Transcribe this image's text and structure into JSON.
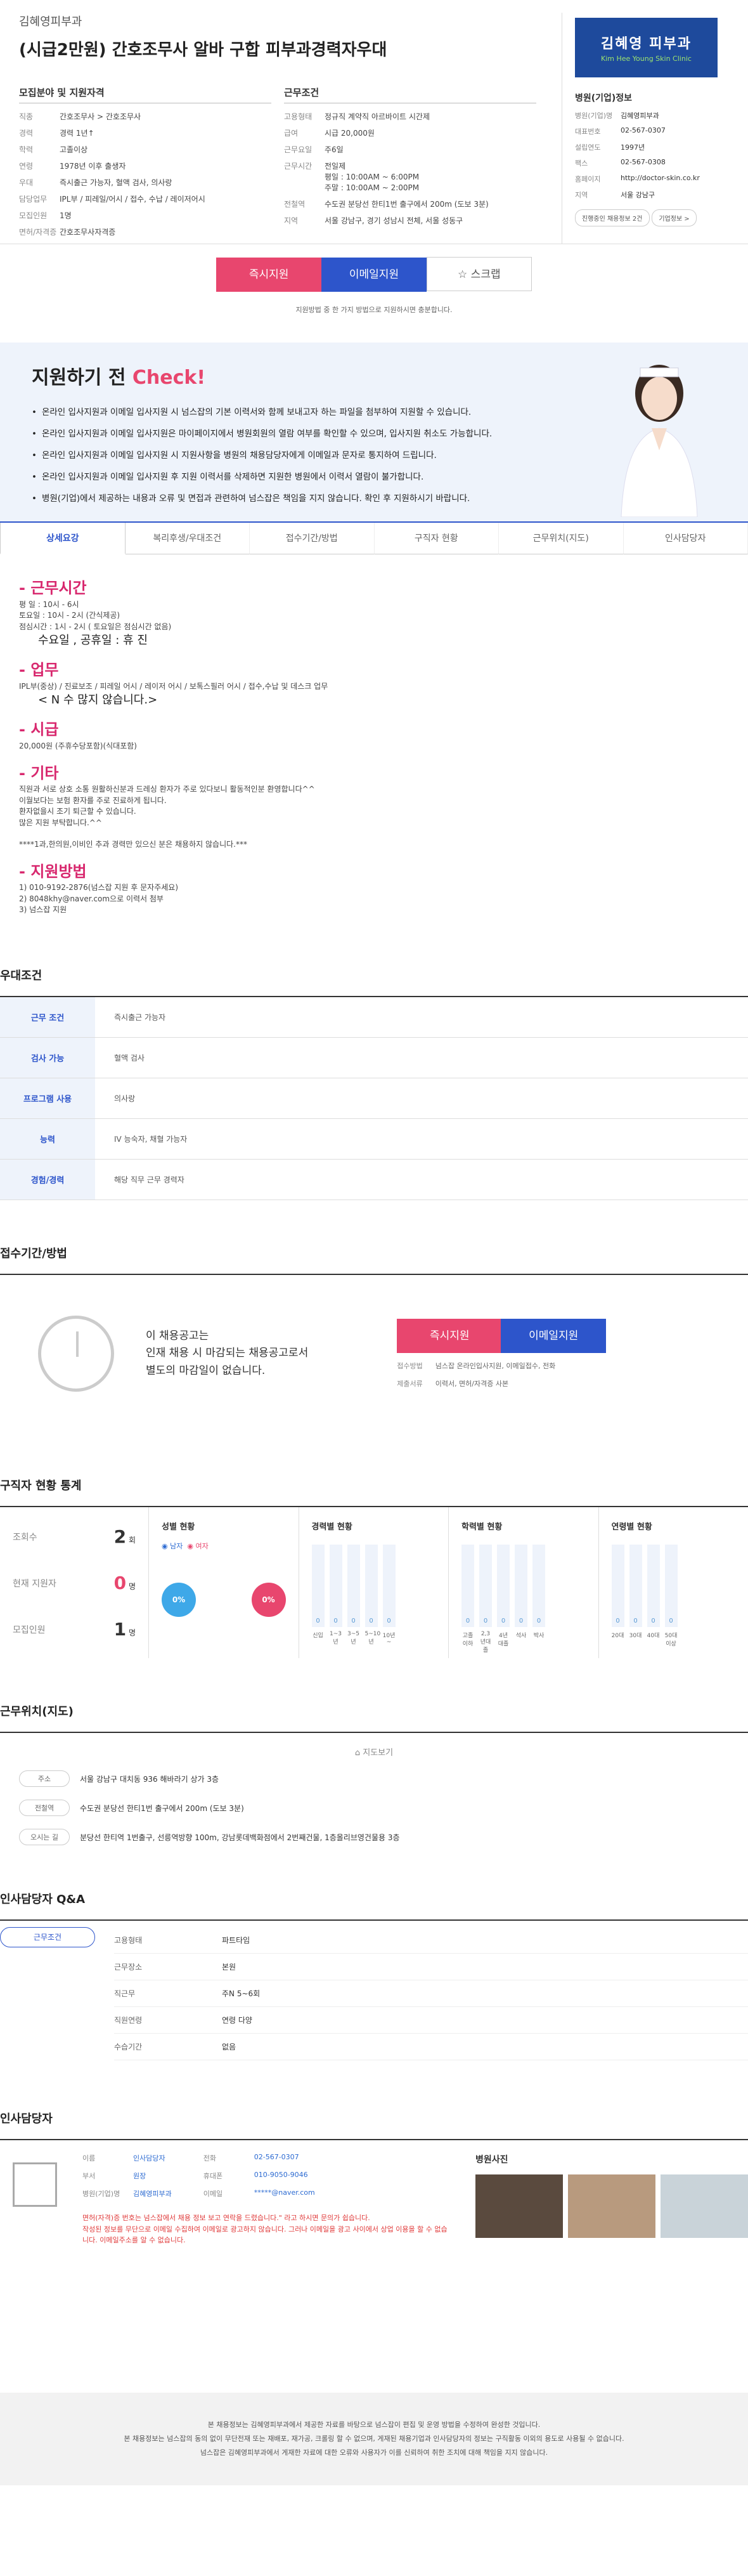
{
  "header": {
    "clinic": "김혜영피부과",
    "title": "(시급2만원) 간호조무사 알바 구합 피부과경력자우대"
  },
  "recruit": {
    "title": "모집분야 및 지원자격",
    "rows": [
      {
        "k": "직종",
        "v": "간호조무사 > 간호조무사"
      },
      {
        "k": "경력",
        "v": "경력 1년↑"
      },
      {
        "k": "학력",
        "v": "고졸이상"
      },
      {
        "k": "연령",
        "v": "1978년 이후 출생자"
      },
      {
        "k": "우대",
        "v": "즉시출근 가능자, 혈액 검사, 의사랑"
      },
      {
        "k": "담당업무",
        "v": "IPL부 / 피레일/어시 / 접수, 수납 / 레이저어시"
      },
      {
        "k": "모집인원",
        "v": "1명"
      },
      {
        "k": "면허/자격증",
        "v": "간호조무사자격증"
      }
    ]
  },
  "work": {
    "title": "근무조건",
    "rows": [
      {
        "k": "고용형태",
        "v": "정규직  계약직  아르바이트  시간제"
      },
      {
        "k": "급여",
        "v": "시급 20,000원"
      },
      {
        "k": "근무요일",
        "v": "주6일"
      },
      {
        "k": "근무시간",
        "v": "전일제\n평일 : 10:00AM ~ 6:00PM\n주말 : 10:00AM ~ 2:00PM"
      },
      {
        "k": "전철역",
        "v": "수도권 분당선 한티1번 출구에서 200m (도보 3분)"
      },
      {
        "k": "지역",
        "v": "서울 강남구, 경기 성남시 전체, 서울 성동구"
      }
    ]
  },
  "hospital": {
    "logo1": "김혜영 피부과",
    "logo2": "Kim Hee Young Skin Clinic",
    "title": "병원(기업)정보",
    "rows": [
      {
        "k": "병원(기업)명",
        "v": "김혜영피부과"
      },
      {
        "k": "대표번호",
        "v": "02-567-0307"
      },
      {
        "k": "설립연도",
        "v": "1997년"
      },
      {
        "k": "팩스",
        "v": "02-567-0308"
      },
      {
        "k": "홈페이지",
        "v": "http://doctor-skin.co.kr"
      },
      {
        "k": "지역",
        "v": "서울 강남구"
      }
    ],
    "btn1": "진행중인 채용정보 2건",
    "btn2": "기업정보 >"
  },
  "apply": {
    "instant": "즉시지원",
    "email": "이메일지원",
    "scrap": "☆ 스크랩",
    "note": "지원방법 중 한 가지 방법으로 지원하시면 충분합니다."
  },
  "check": {
    "t1": "지원하기 전 ",
    "t2": "Check!",
    "items": [
      "온라인 입사지원과 이메일 입사지원 시 넘스잡의 기본 이력서와 함께 보내고자 하는 파일을 첨부하여 지원할 수 있습니다.",
      "온라인 입사지원과 이메일 입사지원은 마이페이지에서 병원회원의 열람 여부를 확인할 수 있으며, 입사지원 취소도 가능합니다.",
      "온라인 입사지원과 이메일 입사지원 시 지원사항을 병원의 채용담당자에게 이메일과 문자로 통지하여 드립니다.",
      "온라인 입사지원과 이메일 입사지원 후 지원 이력서를 삭제하면 지원한 병원에서 이력서 열람이 불가합니다.",
      "병원(기업)에서 제공하는 내용과 오류 및 면접과 관련하여 넘스잡은 책임을 지지 않습니다. 확인 후 지원하시기 바랍니다."
    ]
  },
  "tabs": [
    "상세요강",
    "복리후생/우대조건",
    "접수기간/방법",
    "구직자 현황",
    "근무위치(지도)",
    "인사담당자"
  ],
  "detail": [
    {
      "h": "- 근무시간",
      "t": "평  일 : 10시 - 6시\n토요일 : 10시 - 2시 (간식제공)\n점심시간 : 1시 - 2시 ( 토요일은 점심시간 없음)",
      "b": "수요일 , 공휴일 : 휴 진"
    },
    {
      "h": "- 업무",
      "t": "IPL부(중상) / 진료보조 / 피레일 어시 / 레이저 어시 / 보톡스필러 어시 / 접수,수납 및 데스크 업무",
      "b": "< N 수 많지 않습니다.>"
    },
    {
      "h": "- 시급",
      "t": "20,000원 (주휴수당포함)(식대포함)",
      "b": ""
    },
    {
      "h": "- 기타",
      "t": "직원과 서로 상호 소통 원활하신분과 드레싱 환자가 주로 있다보니 활동적인분 환영합니다^^\n이월보다는 보험 환자를 주로 진료하게 됩니다.\n환자없을시 조기 퇴근할 수 있습니다.\n많은 지원 부탁합니다.^^\n\n****1과,한의원,이비인 추과 경력만 있으신 분은 채용하지 않습니다.***",
      "b": ""
    },
    {
      "h": "- 지원방법",
      "t": "1) 010-9192-2876(넘스잡 지원 후 문자주세요)\n2) 8048khy@naver.com으로 이력서 첨부\n3) 넘스잡 지원",
      "b": ""
    }
  ],
  "pref": {
    "title": "우대조건",
    "rows": [
      {
        "k": "근무 조건",
        "v": "즉시출근 가능자"
      },
      {
        "k": "검사 가능",
        "v": "혈액 검사"
      },
      {
        "k": "프로그램 사용",
        "v": "의사랑"
      },
      {
        "k": "능력",
        "v": "IV 능숙자, 채혈 가능자"
      },
      {
        "k": "경험/경력",
        "v": "해당 직무 근무 경력자"
      }
    ]
  },
  "receive": {
    "title": "접수기간/방법",
    "text": "이 채용공고는\n인재 채용 시 마감되는 채용공고로서\n별도의 마감일이 없습니다.",
    "instant": "즉시지원",
    "email": "이메일지원",
    "m1k": "접수방법",
    "m1v": "넘스잡 온라인입사지원, 이메일접수, 전화",
    "m2k": "제출서류",
    "m2v": "이력서, 면허/자격증 사본"
  },
  "status": {
    "title": "구직자 현황 통계",
    "views_k": "조회수",
    "views_v": "2",
    "views_u": "회",
    "applicants_k": "현재 지원자",
    "applicants_v": "0",
    "applicants_u": "명",
    "hires_k": "모집인원",
    "hires_v": "1",
    "hires_u": "명",
    "gender": {
      "title": "성별 현황",
      "male": "남자",
      "female": "여자",
      "male_v": "0%",
      "female_v": "0%"
    },
    "career": {
      "title": "경력별 현황",
      "labels": [
        "신입",
        "1~3년",
        "3~5년",
        "5~10년",
        "10년~"
      ],
      "values": [
        "0",
        "0",
        "0",
        "0",
        "0"
      ]
    },
    "edu": {
      "title": "학력별 현황",
      "labels": [
        "고졸이하",
        "2,3년대졸",
        "4년대졸",
        "석사",
        "박사"
      ],
      "values": [
        "0",
        "0",
        "0",
        "0",
        "0"
      ]
    },
    "age": {
      "title": "연령별 현황",
      "labels": [
        "20대",
        "30대",
        "40대",
        "50대이상"
      ],
      "values": [
        "0",
        "0",
        "0",
        "0"
      ]
    }
  },
  "map": {
    "title": "근무위치(지도)",
    "btn": "지도보기",
    "rows": [
      {
        "k": "주소",
        "v": "서울 강남구 대치동 936 해바라기 상가 3층"
      },
      {
        "k": "전철역",
        "v": "수도권 분당선 한티1번 출구에서 200m (도보 3분)"
      },
      {
        "k": "오시는 길",
        "v": "분당선 한티역 1번출구, 선릉역방향 100m, 강남롯데백화점에서 2번째건물, 1층올리브영건물용 3층"
      }
    ]
  },
  "qa": {
    "title": "인사담당자 Q&A",
    "tag": "근무조건",
    "rows": [
      {
        "k": "고용형태",
        "v": "파트타임"
      },
      {
        "k": "근무장소",
        "v": "본원"
      },
      {
        "k": "직근무",
        "v": "주N 5~6회"
      },
      {
        "k": "직원연령",
        "v": "연령 다양"
      },
      {
        "k": "수습기간",
        "v": "없음"
      }
    ]
  },
  "manager": {
    "title": "인사담당자",
    "rows1": [
      {
        "k": "이름",
        "v": "인사담당자"
      },
      {
        "k": "부서",
        "v": "원장"
      },
      {
        "k": "병원(기업)명",
        "v": "김혜영피부과"
      }
    ],
    "rows2": [
      {
        "k": "전화",
        "v": "02-567-0307"
      },
      {
        "k": "휴대폰",
        "v": "010-9050-9046"
      },
      {
        "k": "이메일",
        "v": "*****@naver.com"
      }
    ],
    "warn": "면허(자격)증 번호는 넘스잡에서 채용 정보 보고 연락을 드렸습니다.\" 라고 하시면 문의가 쉽습니다.\n작성된 정보를 무단으로 이메일 수집하여 이메일로 광고하지 않습니다. 그러나 이메일을 광고 사이에서 상업 이용을 할 수 없습니다. 이메일주소를 알 수 없습니다.",
    "photos": "병원사진"
  },
  "footer": {
    "l1": "본 채용정보는 김혜영피부과에서 제공한 자료를 바탕으로 넘스잡이 편집 및 운영 방법을 수정하여 완성한 것입니다.",
    "l2": "본 채용정보는 넘스잡의 동의 없이 무단전재 또는 재배포, 재가공, 크롤링 할 수 없으며, 게재된 채용기업과 인사담당자의 정보는 구직활동 이외의 용도로 사용될 수 없습니다.",
    "l3": "넘스잡은 김혜영피부과에서 게재한 자료에 대한 오류와 사용자가 이를 신뢰하여 취한 조치에 대해 책임을 지지 않습니다."
  }
}
